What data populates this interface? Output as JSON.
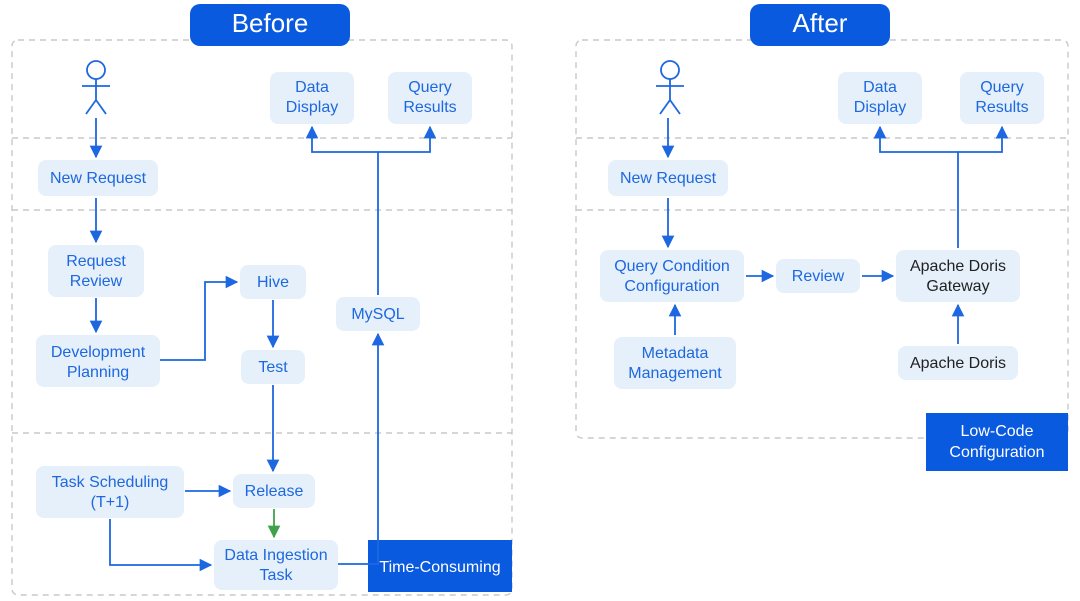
{
  "headers": {
    "before": "Before",
    "after": "After"
  },
  "before": {
    "new_request": "New Request",
    "data_display": [
      "Data",
      "Display"
    ],
    "query_results": [
      "Query",
      "Results"
    ],
    "request_review": [
      "Request",
      "Review"
    ],
    "dev_planning": [
      "Development",
      "Planning"
    ],
    "hive": "Hive",
    "test": "Test",
    "mysql": "MySQL",
    "task_scheduling": [
      "Task Scheduling",
      "(T+1)"
    ],
    "release": "Release",
    "data_ingestion": [
      "Data Ingestion",
      "Task"
    ],
    "badge": "Time-Consuming"
  },
  "after": {
    "new_request": "New Request",
    "data_display": [
      "Data",
      "Display"
    ],
    "query_results": [
      "Query",
      "Results"
    ],
    "query_condition": [
      "Query Condition",
      "Configuration"
    ],
    "review": "Review",
    "doris_gateway": [
      "Apache Doris",
      "Gateway"
    ],
    "metadata_mgmt": [
      "Metadata",
      "Management"
    ],
    "apache_doris": "Apache Doris",
    "badge": [
      "Low-Code",
      "Configuration"
    ]
  }
}
